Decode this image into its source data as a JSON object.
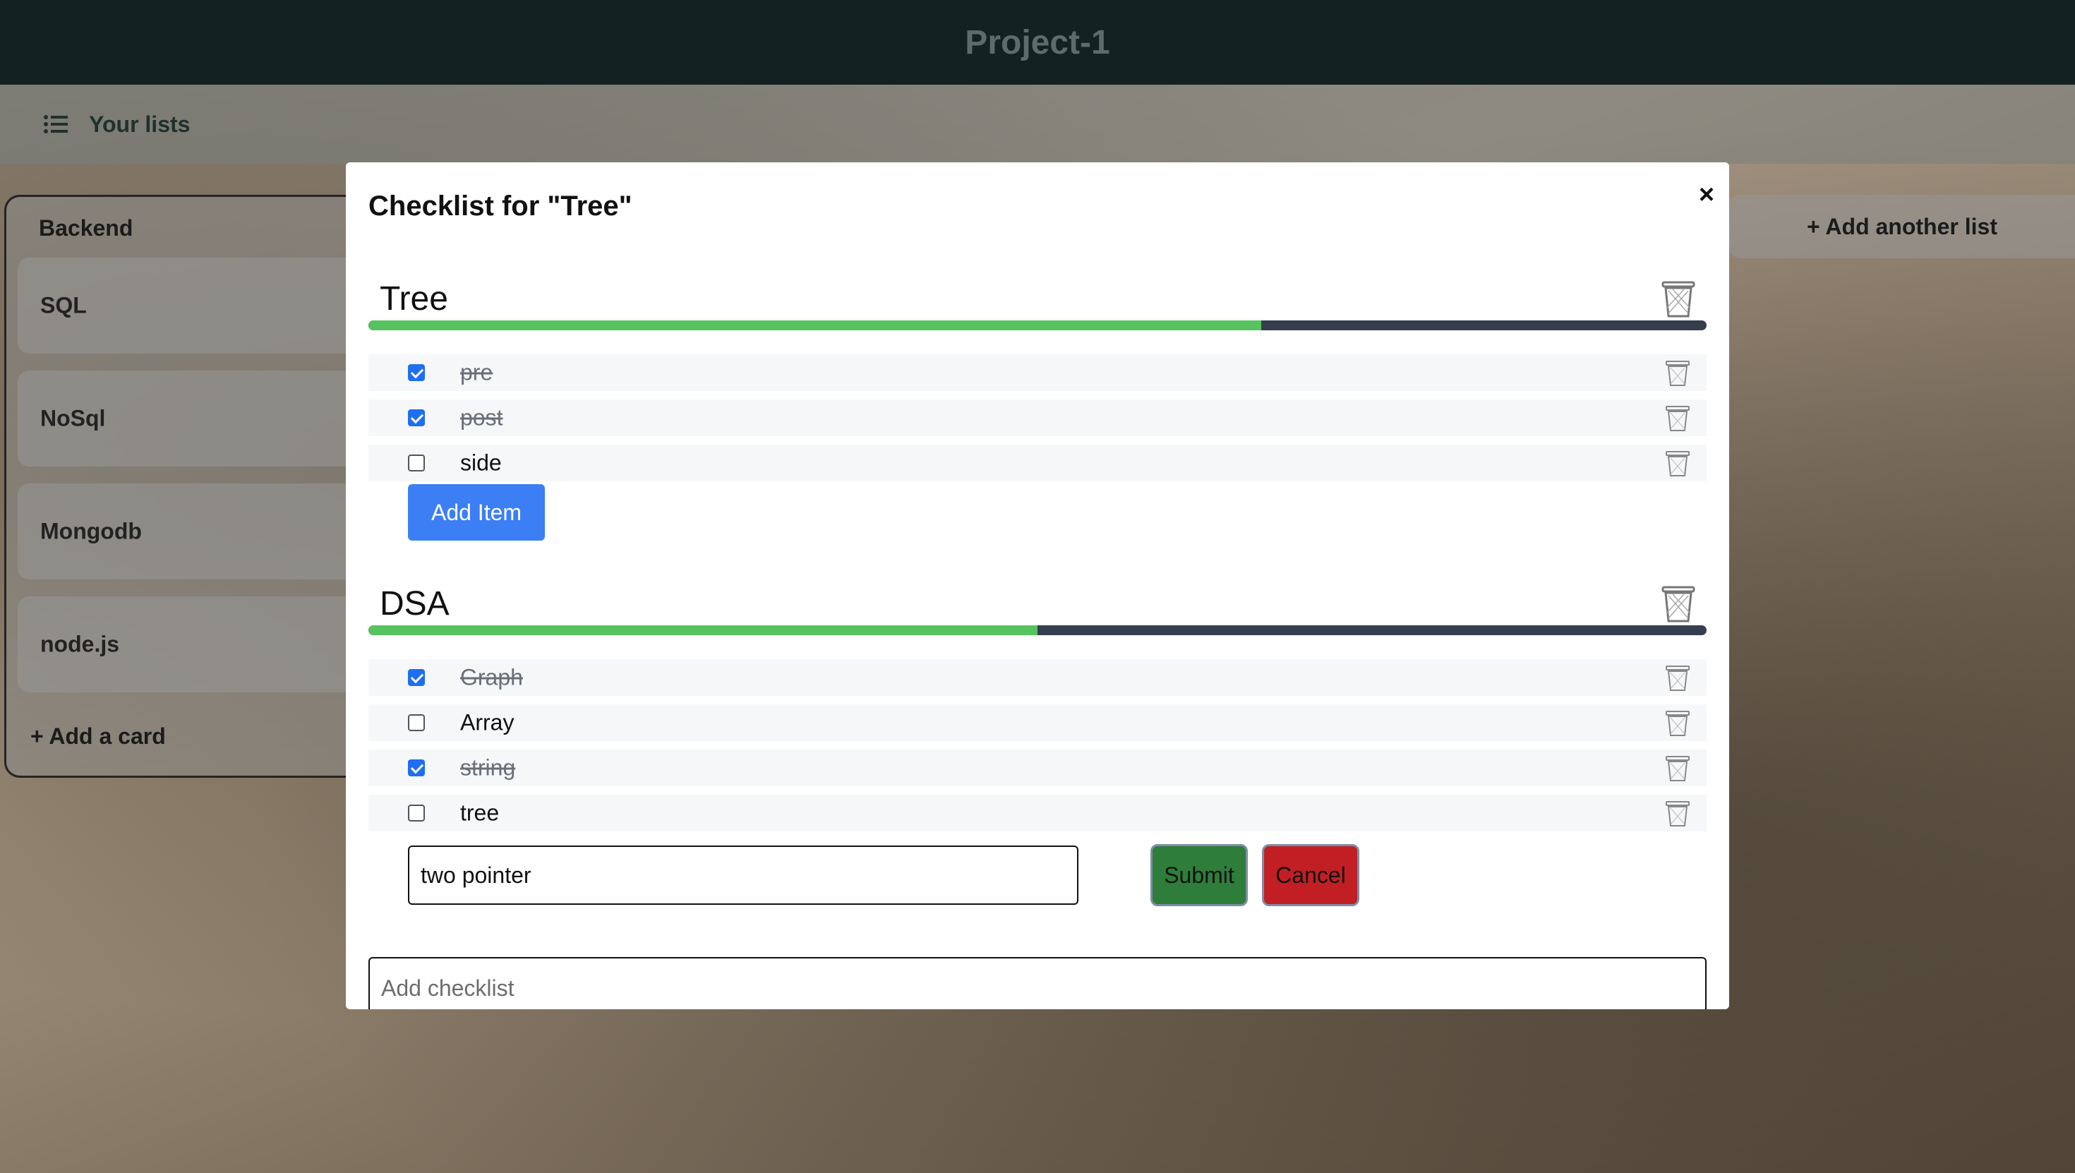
{
  "app": {
    "title": "Project-1"
  },
  "subbar": {
    "label": "Your lists",
    "icon": "list-icon"
  },
  "board": {
    "list": {
      "title": "Backend",
      "cards": [
        "SQL",
        "NoSql",
        "Mongodb",
        "node.js"
      ],
      "add_card_label": "+ Add a card"
    },
    "add_list_label": "+ Add another list"
  },
  "modal": {
    "title": "Checklist for \"Tree\"",
    "close_label": "×",
    "checklists": [
      {
        "title": "Tree",
        "progress": 0.667,
        "items": [
          {
            "text": "pre",
            "checked": true
          },
          {
            "text": "post",
            "checked": true
          },
          {
            "text": "side",
            "checked": false
          }
        ],
        "add_item_label": "Add Item"
      },
      {
        "title": "DSA",
        "progress": 0.5,
        "items": [
          {
            "text": "Graph",
            "checked": true
          },
          {
            "text": "Array",
            "checked": false
          },
          {
            "text": "string",
            "checked": true
          },
          {
            "text": "tree",
            "checked": false
          }
        ],
        "new_item_value": "two pointer",
        "submit_label": "Submit",
        "cancel_label": "Cancel"
      }
    ],
    "add_checklist_placeholder": "Add checklist"
  },
  "colors": {
    "progress_fill": "#56c35f",
    "progress_track": "#363d4f",
    "primary_button": "#3c7ff5",
    "submit_button": "#2e7d3a",
    "cancel_button": "#c21f24"
  }
}
